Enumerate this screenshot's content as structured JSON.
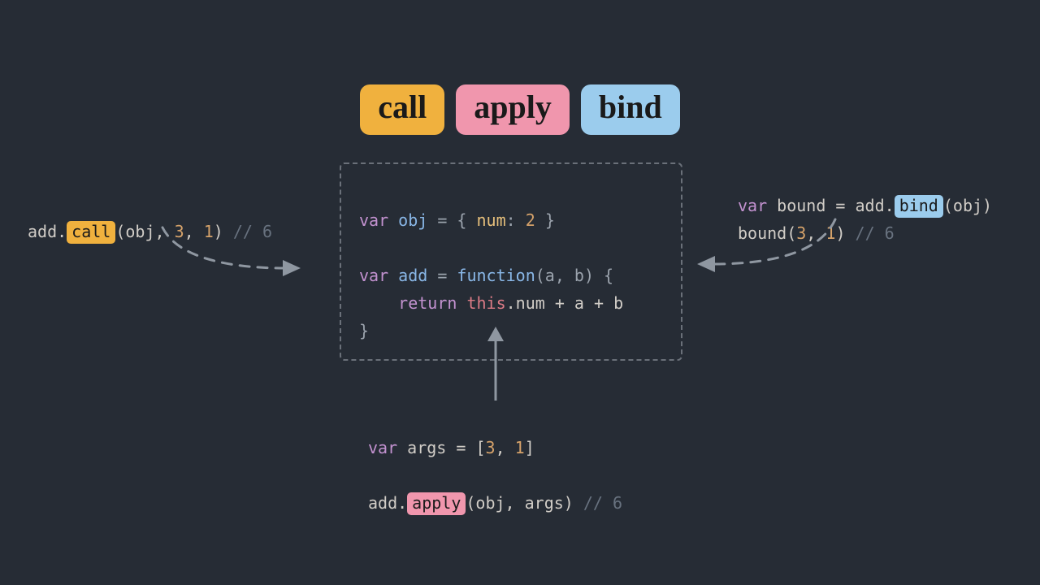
{
  "badges": {
    "call": "call",
    "apply": "apply",
    "bind": "bind"
  },
  "center": {
    "l1_var": "var",
    "l1_id": "obj",
    "l1_eq": " = { ",
    "l1_key": "num",
    "l1_col": ": ",
    "l1_val": "2",
    "l1_end": " }",
    "l3_var": "var",
    "l3_id": "add",
    "l3_eq": " = ",
    "l3_fn": "function",
    "l3_args": "(a, b) {",
    "l4_ret": "return",
    "l4_this": "this",
    "l4_rest": ".num + a + b",
    "l5": "}"
  },
  "call_snip": {
    "prefix": "add.",
    "method": "call",
    "args": "(obj, ",
    "n1": "3",
    "c1": ", ",
    "n2": "1",
    "close": ")",
    "comment": " // 6"
  },
  "bind_snip": {
    "l1_var": "var",
    "l1_id": "bound",
    "l1_eq": " = add.",
    "l1_method": "bind",
    "l1_args": "(obj)",
    "l2_pre": "bound(",
    "l2_n1": "3",
    "l2_c": ", ",
    "l2_n2": "1",
    "l2_close": ")",
    "l2_comment": " // 6"
  },
  "apply_snip": {
    "l1_var": "var",
    "l1_id": "args",
    "l1_eq": " = [",
    "l1_n1": "3",
    "l1_c": ", ",
    "l1_n2": "1",
    "l1_close": "]",
    "l2_pre": "add.",
    "l2_method": "apply",
    "l2_args": "(obj, args)",
    "l2_comment": " // 6"
  }
}
